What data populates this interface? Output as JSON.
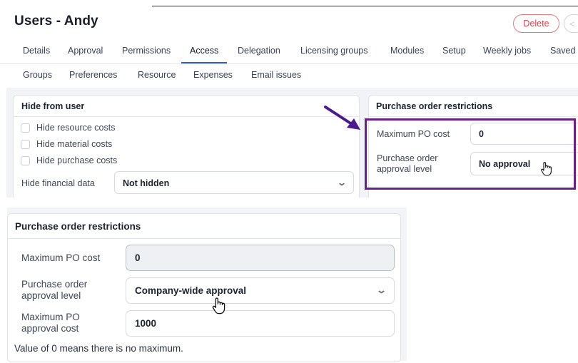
{
  "header": {
    "title": "Users - Andy",
    "delete_label": "Delete",
    "back_glyph": "<"
  },
  "tabs_primary": [
    {
      "label": "Details"
    },
    {
      "label": "Approval"
    },
    {
      "label": "Permissions"
    },
    {
      "label": "Access",
      "active": true
    },
    {
      "label": "Delegation"
    },
    {
      "label": "Licensing groups"
    },
    {
      "label": "Modules"
    },
    {
      "label": "Setup"
    },
    {
      "label": "Weekly jobs"
    },
    {
      "label": "Saved"
    }
  ],
  "tabs_secondary": [
    {
      "label": "Groups"
    },
    {
      "label": "Preferences"
    },
    {
      "label": "Resource"
    },
    {
      "label": "Expenses"
    },
    {
      "label": "Email issues"
    }
  ],
  "hide_from_user": {
    "title": "Hide from user",
    "options": [
      {
        "label": "Hide resource costs",
        "checked": false
      },
      {
        "label": "Hide material costs",
        "checked": false
      },
      {
        "label": "Hide purchase costs",
        "checked": false
      }
    ],
    "financial_label": "Hide financial data",
    "financial_value": "Not hidden"
  },
  "po_restrictions_top": {
    "title": "Purchase order restrictions",
    "max_cost_label": "Maximum PO cost",
    "max_cost_value": "0",
    "approval_label": "Purchase order approval level",
    "approval_value": "No approval"
  },
  "po_restrictions_bottom": {
    "title": "Purchase order restrictions",
    "max_cost_label": "Maximum PO cost",
    "max_cost_value": "0",
    "approval_label": "Purchase order approval level",
    "approval_value": "Company-wide approval",
    "max_approval_label": "Maximum PO approval cost",
    "max_approval_value": "1000",
    "note": "Value of 0 means there is no maximum."
  },
  "colors": {
    "accent_tab": "#2f5fbe",
    "highlight_box": "#6b1f8a",
    "arrow": "#4b1a8c",
    "delete": "#d9434d"
  },
  "icons": [
    "chevron-down-icon",
    "hand-cursor-icon",
    "annotation-arrow-icon"
  ]
}
